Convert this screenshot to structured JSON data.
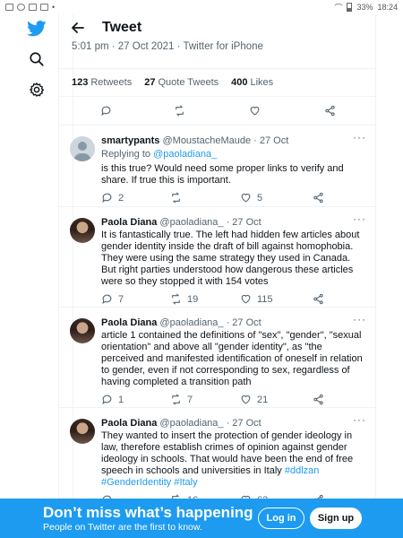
{
  "status_bar": {
    "battery": "33%",
    "time": "18:24"
  },
  "header": {
    "title": "Tweet"
  },
  "tweet": {
    "meta": "5:01 pm · 27 Oct 2021 · Twitter for iPhone",
    "retweets_count": "123",
    "retweets_label": "Retweets",
    "quote_count": "27",
    "quote_label": "Quote Tweets",
    "likes_count": "400",
    "likes_label": "Likes"
  },
  "replies": [
    {
      "name": "smartypants",
      "handle": "@MoustacheMaude · 27 Oct",
      "replying_prefix": "Replying to ",
      "replying_to": "@paoladiana_",
      "text": "is this true?  Would need some proper links to verify and share.  If true this is important.",
      "reply_count": "2",
      "retweet_count": "",
      "like_count": "5"
    },
    {
      "name": "Paola Diana",
      "handle": "@paoladiana_ · 27 Oct",
      "text": "It is fantastically true. The left had hidden few articles about gender identity inside the draft of bill against homophobia. They were using the same strategy they used in Canada. But right parties understood how dangerous these articles were so they stopped it with 154 votes",
      "reply_count": "7",
      "retweet_count": "19",
      "like_count": "115"
    },
    {
      "name": "Paola Diana",
      "handle": "@paoladiana_ · 27 Oct",
      "text": "article 1 contained the definitions of \"sex\", \"gender\", \"sexual orientation\" and above all \"gender identity\", as \"the perceived and manifested identification of oneself in relation to gender, even if not corresponding to sex, regardless of having completed a transition path",
      "reply_count": "1",
      "retweet_count": "7",
      "like_count": "21"
    },
    {
      "name": "Paola Diana",
      "handle": "@paoladiana_ · 27 Oct",
      "text": "They wanted to insert the protection of gender ideology in law, therefore establish crimes of opinion against gender ideology in schools. That would have been the end of free speech in schools and universities in Italy ",
      "tags": "#ddlzan #GenderIdentity #Italy",
      "reply_count": "",
      "retweet_count": "16",
      "like_count": "63"
    }
  ],
  "banner": {
    "title": "Don’t miss what’s happening",
    "subtitle": "People on Twitter are the first to know.",
    "login": "Log in",
    "signup": "Sign up"
  },
  "icons": {
    "twitter": "bird-icon",
    "search": "search-icon",
    "settings": "gear-icon",
    "back": "arrow-left-icon",
    "reply": "comment-icon",
    "retweet": "retweet-icon",
    "like": "heart-icon",
    "share": "share-icon",
    "more": "more-icon"
  },
  "colors": {
    "accent": "#1d9bf0",
    "text": "#0f1419",
    "muted": "#536471"
  }
}
